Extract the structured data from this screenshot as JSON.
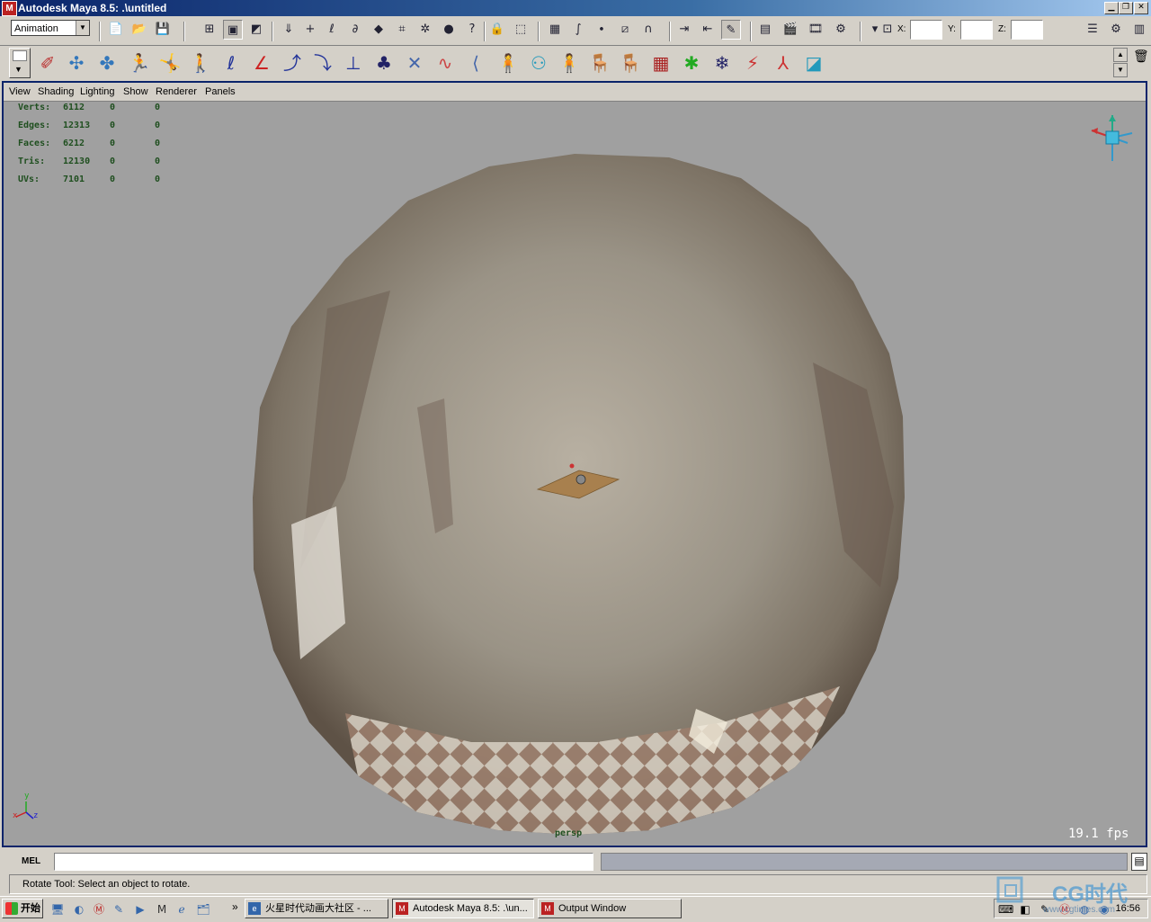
{
  "window": {
    "title": "Autodesk Maya 8.5: .\\untitled",
    "controls": [
      "minimize",
      "restore",
      "close"
    ]
  },
  "status_line": {
    "menu_set": "Animation",
    "coords": {
      "x_label": "X:",
      "y_label": "Y:",
      "z_label": "Z:"
    }
  },
  "panel": {
    "menus": [
      "View",
      "Shading",
      "Lighting",
      "Show",
      "Renderer",
      "Panels"
    ],
    "hud": [
      {
        "label": "Verts:",
        "value": "6112",
        "sel1": "0",
        "sel2": "0"
      },
      {
        "label": "Edges:",
        "value": "12313",
        "sel1": "0",
        "sel2": "0"
      },
      {
        "label": "Faces:",
        "value": "6212",
        "sel1": "0",
        "sel2": "0"
      },
      {
        "label": "Tris:",
        "value": "12130",
        "sel1": "0",
        "sel2": "0"
      },
      {
        "label": "UVs:",
        "value": "7101",
        "sel1": "0",
        "sel2": "0"
      }
    ],
    "camera": "persp",
    "fps": "19.1 fps",
    "axis_labels": {
      "x": "x",
      "y": "y",
      "z": "z"
    }
  },
  "command_line": {
    "label": "MEL",
    "value": ""
  },
  "help_line": "Rotate Tool: Select an object to rotate.",
  "taskbar": {
    "start_label": "开始",
    "overflow": "»",
    "tasks": [
      {
        "label": "火星时代动画大社区 - ...",
        "active": false
      },
      {
        "label": "Autodesk Maya 8.5: .\\un...",
        "active": true
      },
      {
        "label": "Output Window",
        "active": false
      }
    ],
    "clock": "16:56"
  },
  "watermark": {
    "brand": "CG时代",
    "url": "www.cgtimes.com"
  },
  "colors": {
    "viewport_bg": "#a0a0a0",
    "hud_text": "#1f4f1f",
    "title_bar": "#0a246a",
    "sphere": "#8c877c"
  }
}
